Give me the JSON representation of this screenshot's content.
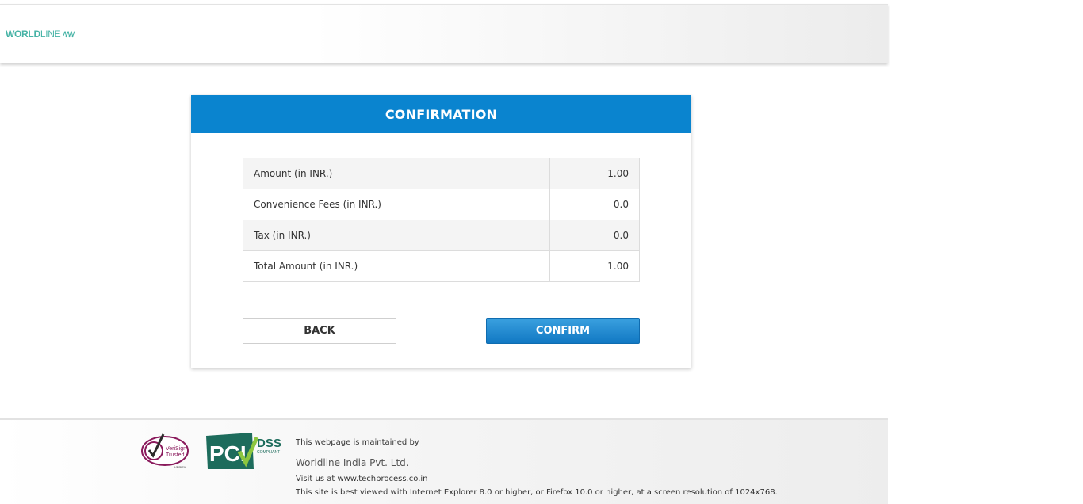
{
  "header": {
    "logo": {
      "bold": "WORLD",
      "thin": "LINE",
      "icon": "worldline-waves-icon",
      "color": "#46b3a6"
    }
  },
  "card": {
    "title": "CONFIRMATION",
    "header_color": "#0a84cf",
    "rows": [
      {
        "label": "Amount (in INR.)",
        "value": "1.00"
      },
      {
        "label": "Convenience Fees (in INR.)",
        "value": "0.0"
      },
      {
        "label": "Tax (in INR.)",
        "value": "0.0"
      },
      {
        "label": "Total Amount (in INR.)",
        "value": "1.00"
      }
    ],
    "back_label": "BACK",
    "confirm_label": "CONFIRM"
  },
  "footer": {
    "verisign": {
      "line1": "VeriSign",
      "line2": "Trusted",
      "line3": "VERIFY"
    },
    "pci": {
      "letters": "PCI",
      "dss": "DSS",
      "compliant": "COMPLIANT"
    },
    "maintained_by": "This webpage is maintained by",
    "company": "Worldline India Pvt. Ltd.",
    "visit": "Visit us at www.techprocess.co.in",
    "browser_note": "This site is best viewed with Internet Explorer 8.0 or higher, or Firefox 10.0 or higher, at a screen resolution of 1024x768."
  }
}
